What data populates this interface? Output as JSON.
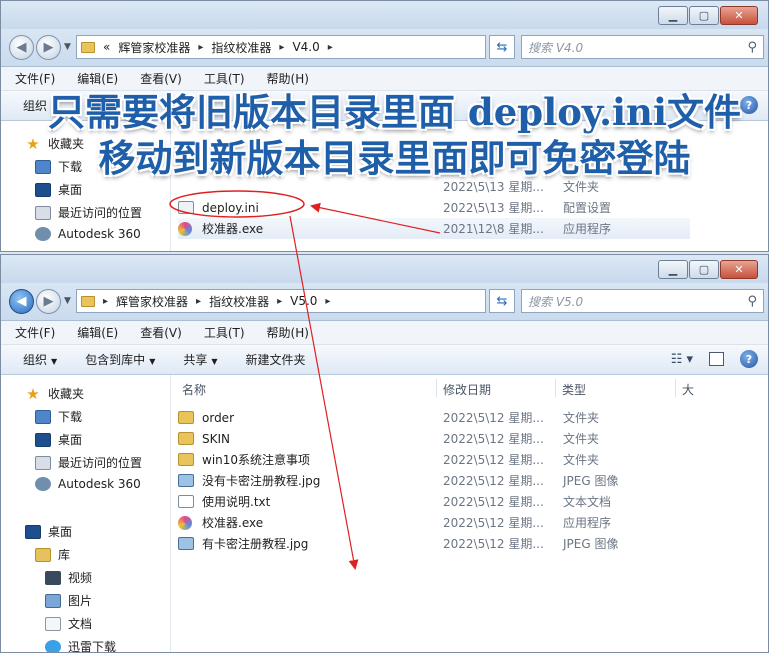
{
  "window_top": {
    "breadcrumb": [
      "«",
      "辉管家校准器",
      "指纹校准器",
      "V4.0"
    ],
    "search_placeholder": "搜索 V4.0",
    "menu": [
      "文件(F)",
      "编辑(E)",
      "查看(V)",
      "工具(T)",
      "帮助(H)"
    ],
    "toolbar": {
      "organize": "组织"
    },
    "sidebar": [
      {
        "label": "收藏夹",
        "icon": "star-icon"
      },
      {
        "label": "下载",
        "icon": "download-folder-icon"
      },
      {
        "label": "桌面",
        "icon": "desktop-icon"
      },
      {
        "label": "最近访问的位置",
        "icon": "recent-places-icon"
      },
      {
        "label": "Autodesk 360",
        "icon": "autodesk-icon"
      }
    ],
    "files": [
      {
        "name": "deploy.ini",
        "date": "2022\\5\\13 星期...",
        "type": "配置设置",
        "icon": "ini-file-icon"
      },
      {
        "name": "校准器.exe",
        "date": "2021\\12\\8 星期...",
        "type": "应用程序",
        "icon": "exe-file-icon"
      }
    ],
    "partial_row": {
      "date": "2022\\5\\13 星期...",
      "type": "文件夹"
    }
  },
  "window_bottom": {
    "breadcrumb": [
      "辉管家校准器",
      "指纹校准器",
      "V5.0"
    ],
    "search_placeholder": "搜索 V5.0",
    "menu": [
      "文件(F)",
      "编辑(E)",
      "查看(V)",
      "工具(T)",
      "帮助(H)"
    ],
    "toolbar": {
      "organize": "组织",
      "include_library": "包含到库中",
      "share": "共享",
      "new_folder": "新建文件夹"
    },
    "columns": {
      "name": "名称",
      "date": "修改日期",
      "type": "类型",
      "size": "大"
    },
    "sidebar": [
      {
        "label": "收藏夹",
        "icon": "star-icon",
        "level": 0
      },
      {
        "label": "下载",
        "icon": "download-folder-icon",
        "level": 1
      },
      {
        "label": "桌面",
        "icon": "desktop-icon",
        "level": 1
      },
      {
        "label": "最近访问的位置",
        "icon": "recent-places-icon",
        "level": 1
      },
      {
        "label": "Autodesk 360",
        "icon": "autodesk-icon",
        "level": 0
      },
      {
        "label": "桌面",
        "icon": "desktop-icon",
        "level": 0
      },
      {
        "label": "库",
        "icon": "library-icon",
        "level": 1
      },
      {
        "label": "视频",
        "icon": "video-icon",
        "level": 2
      },
      {
        "label": "图片",
        "icon": "pictures-icon",
        "level": 2
      },
      {
        "label": "文档",
        "icon": "documents-icon",
        "level": 2
      },
      {
        "label": "迅雷下载",
        "icon": "thunder-icon",
        "level": 2
      }
    ],
    "files": [
      {
        "name": "order",
        "date": "2022\\5\\12 星期...",
        "type": "文件夹",
        "icon": "folder-icon"
      },
      {
        "name": "SKIN",
        "date": "2022\\5\\12 星期...",
        "type": "文件夹",
        "icon": "folder-icon"
      },
      {
        "name": "win10系统注意事项",
        "date": "2022\\5\\12 星期...",
        "type": "文件夹",
        "icon": "folder-icon"
      },
      {
        "name": "没有卡密注册教程.jpg",
        "date": "2022\\5\\12 星期...",
        "type": "JPEG 图像",
        "icon": "jpg-file-icon"
      },
      {
        "name": "使用说明.txt",
        "date": "2022\\5\\12 星期...",
        "type": "文本文档",
        "icon": "txt-file-icon"
      },
      {
        "name": "校准器.exe",
        "date": "2022\\5\\12 星期...",
        "type": "应用程序",
        "icon": "exe-file-icon"
      },
      {
        "name": "有卡密注册教程.jpg",
        "date": "2022\\5\\12 星期...",
        "type": "JPEG 图像",
        "icon": "jpg-file-icon"
      }
    ]
  },
  "overlay": {
    "line1": "只需要将旧版本目录里面 deploy.ini文件",
    "line2": "移动到新版本目录里面即可免密登陆"
  },
  "annotation_color": "#e02020"
}
